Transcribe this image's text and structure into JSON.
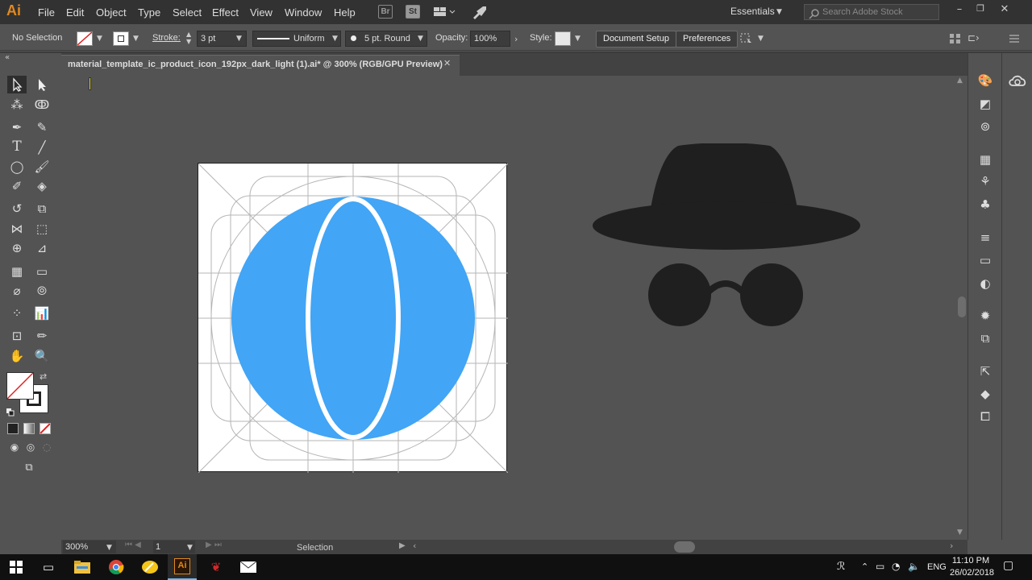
{
  "app": {
    "logo": "Ai"
  },
  "menu": [
    "File",
    "Edit",
    "Object",
    "Type",
    "Select",
    "Effect",
    "View",
    "Window",
    "Help"
  ],
  "menubar_icons": {
    "br": "Br",
    "st": "St"
  },
  "workspace": "Essentials",
  "search": {
    "placeholder": "Search Adobe Stock"
  },
  "control": {
    "selection": "No Selection",
    "stroke_label": "Stroke:",
    "stroke_weight": "3 pt",
    "profile": "Uniform",
    "brush": "5 pt. Round",
    "opacity_label": "Opacity:",
    "opacity": "100%",
    "style_label": "Style:",
    "document_setup": "Document Setup",
    "preferences": "Preferences"
  },
  "document": {
    "title": "material_template_ic_product_icon_192px_dark_light (1).ai* @ 300% (RGB/GPU Preview)"
  },
  "status": {
    "zoom": "300%",
    "artboard": "1",
    "tool": "Selection"
  },
  "taskbar": {
    "lang": "ENG",
    "time": "11:10 PM",
    "date": "26/02/2018"
  },
  "colors": {
    "accent": "#42a5f5",
    "icon_dark": "#1f1f1f",
    "ai_orange": "#e0891f"
  }
}
